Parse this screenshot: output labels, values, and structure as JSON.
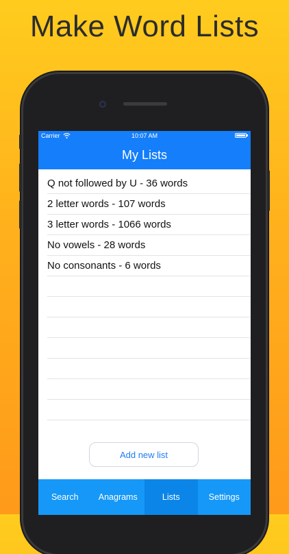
{
  "headline": "Make Word Lists",
  "status_bar": {
    "carrier": "Carrier",
    "time": "10:07 AM"
  },
  "nav": {
    "title": "My Lists"
  },
  "lists": [
    "Q not followed by U - 36 words",
    "2 letter words - 107 words",
    "3 letter words - 1066 words",
    "No vowels - 28 words",
    "No consonants - 6 words"
  ],
  "add_button_label": "Add new list",
  "tabs": [
    {
      "label": "Search",
      "active": false
    },
    {
      "label": "Anagrams",
      "active": false
    },
    {
      "label": "Lists",
      "active": true
    },
    {
      "label": "Settings",
      "active": false
    }
  ],
  "colors": {
    "accent": "#147efb",
    "tab_bar": "#1598f7",
    "background_top": "#ffcc1e",
    "background_bottom": "#ff9a1a"
  },
  "icons": [
    "wifi-icon",
    "battery-icon"
  ]
}
